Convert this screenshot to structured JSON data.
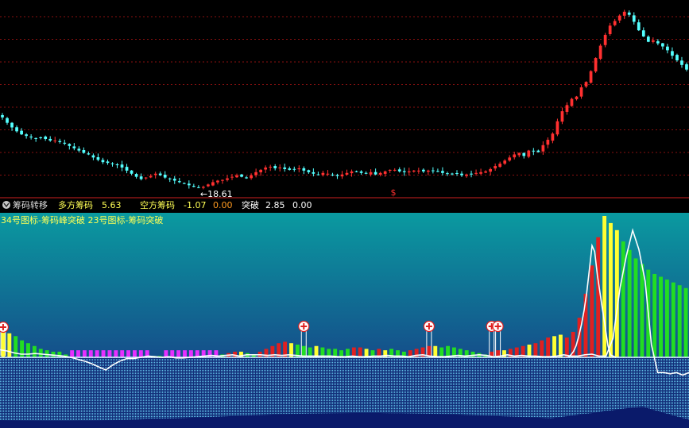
{
  "chart_data": [
    {
      "type": "candlestick",
      "price_annotation": "←18.61",
      "marker_symbol": "$",
      "colors": {
        "up": "#ff3030",
        "down": "#54ffff",
        "grid": "#8a1010"
      },
      "series": [],
      "close": [
        27.9,
        27.2,
        26.6,
        26.1,
        25.7,
        25.5,
        25.3,
        25.2,
        25.3,
        25.1,
        24.9,
        24.9,
        24.7,
        24.5,
        24.2,
        23.9,
        23.6,
        23.3,
        23.1,
        22.7,
        22.4,
        22.1,
        22.0,
        21.9,
        21.7,
        21.4,
        21.0,
        20.6,
        20.2,
        19.9,
        20.1,
        20.3,
        20.6,
        20.4,
        20.1,
        19.9,
        19.7,
        19.5,
        19.3,
        19.1,
        18.9,
        18.8,
        18.9,
        19.2,
        19.5,
        19.7,
        19.8,
        20.0,
        20.2,
        20.4,
        20.2,
        20.0,
        20.4,
        20.8,
        21.1,
        21.4,
        21.5,
        21.3,
        21.4,
        21.2,
        21.1,
        21.2,
        21.3,
        21.0,
        20.8,
        20.6,
        20.5,
        20.7,
        20.6,
        20.4,
        20.3,
        20.5,
        20.7,
        20.9,
        20.9,
        20.7,
        20.6,
        20.8,
        20.5,
        20.7,
        20.9,
        21.1,
        21.1,
        20.9,
        20.8,
        20.9,
        21.0,
        21.0,
        20.9,
        21.0,
        21.0,
        20.9,
        20.7,
        20.6,
        20.6,
        20.6,
        20.4,
        20.5,
        20.6,
        20.7,
        20.8,
        20.9,
        21.2,
        21.6,
        21.9,
        22.3,
        22.7,
        23.1,
        23.3,
        22.9,
        23.6,
        23.5,
        23.4,
        24.3,
        25.0,
        25.8,
        27.4,
        28.7,
        29.5,
        30.3,
        30.6,
        31.8,
        32.5,
        33.9,
        35.6,
        37.2,
        38.6,
        39.8,
        40.4,
        41.1,
        41.6,
        41.2,
        40.3,
        39.2,
        38.4,
        37.7,
        37.9,
        37.5,
        37.1,
        36.6,
        35.9,
        35.3,
        34.7,
        34.1
      ],
      "ylim": [
        18.0,
        42.3
      ]
    },
    {
      "type": "bar",
      "title": "筹码转移",
      "legend": [
        {
          "label": "多方筹码",
          "value": "5.63"
        },
        {
          "label": "空方筹码",
          "value": "-1.07"
        },
        {
          "label": "",
          "value": "0.00"
        },
        {
          "label": "突破",
          "value": "2.85"
        },
        {
          "label": "",
          "value": "0.00"
        }
      ],
      "subtitle": "34号图标-筹码峰突破 23号图标-筹码突破",
      "series": [],
      "bars": [
        {
          "v": 0.2,
          "c": "yellow"
        },
        {
          "v": 0.17,
          "c": "yellow"
        },
        {
          "v": 0.15,
          "c": "green"
        },
        {
          "v": 0.12,
          "c": "green"
        },
        {
          "v": 0.1,
          "c": "green"
        },
        {
          "v": 0.08,
          "c": "green"
        },
        {
          "v": 0.06,
          "c": "green"
        },
        {
          "v": 0.05,
          "c": "green"
        },
        {
          "v": 0.04,
          "c": "green"
        },
        {
          "v": 0.04,
          "c": "green"
        },
        {
          "v": 0.02,
          "c": "green"
        },
        {
          "v": 0.05,
          "c": "magenta"
        },
        {
          "v": 0.05,
          "c": "magenta"
        },
        {
          "v": 0.05,
          "c": "magenta"
        },
        {
          "v": 0.05,
          "c": "magenta"
        },
        {
          "v": 0.05,
          "c": "magenta"
        },
        {
          "v": 0.05,
          "c": "magenta"
        },
        {
          "v": 0.05,
          "c": "magenta"
        },
        {
          "v": 0.05,
          "c": "magenta"
        },
        {
          "v": 0.05,
          "c": "magenta"
        },
        {
          "v": 0.05,
          "c": "magenta"
        },
        {
          "v": 0.05,
          "c": "magenta"
        },
        {
          "v": 0.05,
          "c": "magenta"
        },
        {
          "v": 0.05,
          "c": "magenta"
        },
        {
          "v": 0.01,
          "c": "green"
        },
        {
          "v": 0.01,
          "c": "green"
        },
        {
          "v": 0.05,
          "c": "magenta"
        },
        {
          "v": 0.05,
          "c": "magenta"
        },
        {
          "v": 0.05,
          "c": "magenta"
        },
        {
          "v": 0.05,
          "c": "magenta"
        },
        {
          "v": 0.05,
          "c": "magenta"
        },
        {
          "v": 0.05,
          "c": "magenta"
        },
        {
          "v": 0.05,
          "c": "magenta"
        },
        {
          "v": 0.05,
          "c": "magenta"
        },
        {
          "v": 0.05,
          "c": "magenta"
        },
        {
          "v": 0.02,
          "c": "green"
        },
        {
          "v": 0.03,
          "c": "red"
        },
        {
          "v": 0.04,
          "c": "red"
        },
        {
          "v": 0.04,
          "c": "yellow"
        },
        {
          "v": 0.03,
          "c": "green"
        },
        {
          "v": 0.02,
          "c": "green"
        },
        {
          "v": 0.04,
          "c": "red"
        },
        {
          "v": 0.06,
          "c": "red"
        },
        {
          "v": 0.08,
          "c": "red"
        },
        {
          "v": 0.1,
          "c": "red"
        },
        {
          "v": 0.11,
          "c": "red"
        },
        {
          "v": 0.1,
          "c": "yellow"
        },
        {
          "v": 0.09,
          "c": "green"
        },
        {
          "v": 0.08,
          "c": "green"
        },
        {
          "v": 0.07,
          "c": "green"
        },
        {
          "v": 0.08,
          "c": "yellow"
        },
        {
          "v": 0.07,
          "c": "green"
        },
        {
          "v": 0.06,
          "c": "green"
        },
        {
          "v": 0.06,
          "c": "green"
        },
        {
          "v": 0.05,
          "c": "green"
        },
        {
          "v": 0.06,
          "c": "green"
        },
        {
          "v": 0.07,
          "c": "red"
        },
        {
          "v": 0.07,
          "c": "red"
        },
        {
          "v": 0.06,
          "c": "yellow"
        },
        {
          "v": 0.05,
          "c": "green"
        },
        {
          "v": 0.06,
          "c": "red"
        },
        {
          "v": 0.05,
          "c": "yellow"
        },
        {
          "v": 0.06,
          "c": "green"
        },
        {
          "v": 0.05,
          "c": "green"
        },
        {
          "v": 0.04,
          "c": "green"
        },
        {
          "v": 0.05,
          "c": "red"
        },
        {
          "v": 0.06,
          "c": "red"
        },
        {
          "v": 0.07,
          "c": "red"
        },
        {
          "v": 0.08,
          "c": "red"
        },
        {
          "v": 0.08,
          "c": "yellow"
        },
        {
          "v": 0.07,
          "c": "green"
        },
        {
          "v": 0.08,
          "c": "green"
        },
        {
          "v": 0.07,
          "c": "green"
        },
        {
          "v": 0.06,
          "c": "green"
        },
        {
          "v": 0.05,
          "c": "green"
        },
        {
          "v": 0.04,
          "c": "green"
        },
        {
          "v": 0.03,
          "c": "green"
        },
        {
          "v": 0.02,
          "c": "green"
        },
        {
          "v": 0.04,
          "c": "red"
        },
        {
          "v": 0.05,
          "c": "red"
        },
        {
          "v": 0.05,
          "c": "yellow"
        },
        {
          "v": 0.06,
          "c": "red"
        },
        {
          "v": 0.07,
          "c": "red"
        },
        {
          "v": 0.08,
          "c": "red"
        },
        {
          "v": 0.09,
          "c": "yellow"
        },
        {
          "v": 0.1,
          "c": "red"
        },
        {
          "v": 0.12,
          "c": "red"
        },
        {
          "v": 0.14,
          "c": "red"
        },
        {
          "v": 0.15,
          "c": "yellow"
        },
        {
          "v": 0.16,
          "c": "yellow"
        },
        {
          "v": 0.14,
          "c": "red"
        },
        {
          "v": 0.18,
          "c": "red"
        },
        {
          "v": 0.28,
          "c": "red"
        },
        {
          "v": 0.45,
          "c": "red"
        },
        {
          "v": 0.65,
          "c": "red"
        },
        {
          "v": 0.85,
          "c": "red"
        },
        {
          "v": 1.0,
          "c": "yellow"
        },
        {
          "v": 0.95,
          "c": "yellow"
        },
        {
          "v": 0.9,
          "c": "yellow"
        },
        {
          "v": 0.82,
          "c": "green"
        },
        {
          "v": 0.76,
          "c": "green"
        },
        {
          "v": 0.7,
          "c": "green"
        },
        {
          "v": 0.66,
          "c": "green"
        },
        {
          "v": 0.62,
          "c": "green"
        },
        {
          "v": 0.59,
          "c": "green"
        },
        {
          "v": 0.57,
          "c": "green"
        },
        {
          "v": 0.55,
          "c": "green"
        },
        {
          "v": 0.53,
          "c": "green"
        },
        {
          "v": 0.51,
          "c": "green"
        },
        {
          "v": 0.49,
          "c": "green"
        }
      ],
      "line": [
        0.12,
        0.1,
        0.07,
        0.05,
        0.05,
        0.06,
        0.05,
        0.04,
        0.03,
        0.02,
        0.0,
        -0.03,
        -0.06,
        -0.1,
        -0.15,
        -0.2,
        -0.12,
        -0.06,
        -0.02,
        -0.02,
        0.0,
        0.02,
        0.01,
        0.0,
        0.01,
        -0.01,
        -0.01,
        0.0,
        0.01,
        0.02,
        0.03,
        0.02,
        0.03,
        0.04,
        0.02,
        0.04,
        0.04,
        0.04,
        0.03,
        0.04,
        0.03,
        0.04,
        0.03,
        0.02,
        0.02,
        0.02,
        0.02,
        0.02,
        0.01,
        0.01,
        0.02,
        0.01,
        0.01,
        0.02,
        0.02,
        0.03,
        0.02,
        0.02,
        0.01,
        0.03,
        0.04,
        0.02,
        0.01,
        0.01,
        0.02,
        0.03,
        0.02,
        0.03,
        0.04,
        0.03,
        0.01,
        0.02,
        0.04,
        0.02,
        0.03,
        0.02,
        0.02,
        0.01,
        0.01,
        0.02,
        0.04,
        0.02,
        0.02,
        0.04,
        0.05,
        0.02,
        0.02,
        0.3,
        0.55,
        0.8,
        1.0,
        0.85,
        0.6,
        0.1,
        -0.12,
        -0.12,
        -0.13,
        -0.12,
        -0.14,
        -0.12
      ],
      "line_gap": [
        99,
        145
      ],
      "line2": [
        0.0,
        0.02,
        0.05,
        0.1,
        0.18,
        0.28,
        0.4,
        0.55,
        0.75,
        0.95,
        0.9,
        0.7,
        0.55,
        0.4,
        0.25,
        0.1,
        0.02,
        0.01,
        0.0
      ],
      "markers": [
        0,
        48,
        68,
        78,
        79
      ],
      "colors": {
        "red": "#e02020",
        "yellow": "#ffff33",
        "green": "#22dd22",
        "magenta": "#e630ff",
        "line": "#ffffff"
      }
    }
  ]
}
